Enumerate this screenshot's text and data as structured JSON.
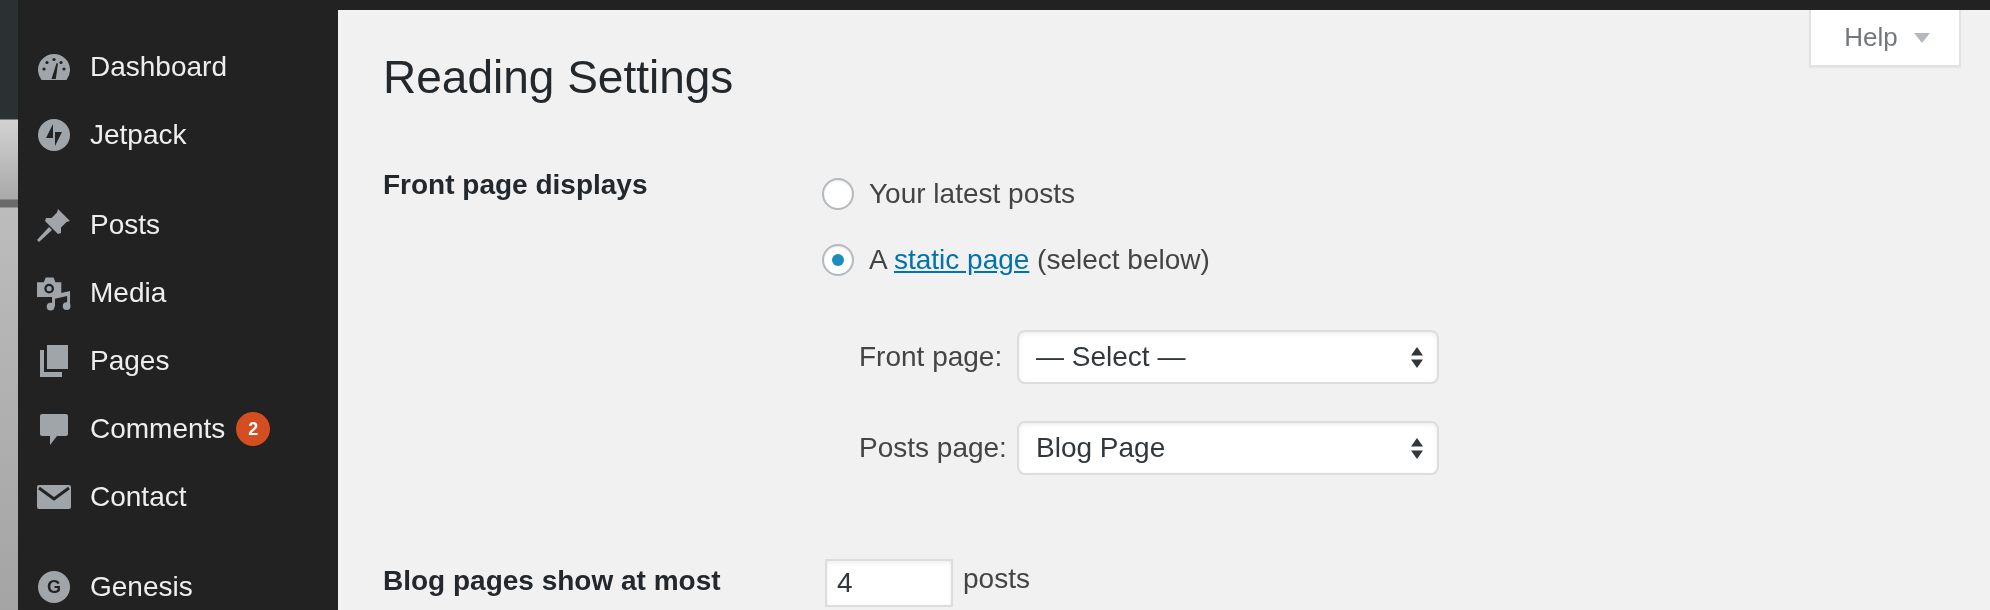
{
  "sidebar": {
    "groups": [
      {
        "items": [
          {
            "label": "Dashboard"
          },
          {
            "label": "Jetpack"
          }
        ]
      },
      {
        "items": [
          {
            "label": "Posts"
          },
          {
            "label": "Media"
          },
          {
            "label": "Pages"
          },
          {
            "label": "Comments",
            "badge": "2"
          },
          {
            "label": "Contact"
          }
        ]
      },
      {
        "items": [
          {
            "label": "Genesis",
            "icon_glyph": "G"
          }
        ]
      }
    ]
  },
  "help_tab": {
    "label": "Help"
  },
  "page_title": "Reading Settings",
  "settings": [
    {
      "kind": "radio_group",
      "label": "Front page displays",
      "options": [
        {
          "text": "Your latest posts",
          "selected": false
        },
        {
          "text": "A",
          "link": "static page",
          "after": "(select below)",
          "selected": true
        }
      ],
      "selects": [
        {
          "label": "Front page:",
          "value": "— Select —"
        },
        {
          "label": "Posts page:",
          "value": "Blog Page"
        }
      ]
    },
    {
      "kind": "number",
      "label": "Blog pages show at most",
      "value": "4",
      "unit": "posts"
    }
  ]
}
